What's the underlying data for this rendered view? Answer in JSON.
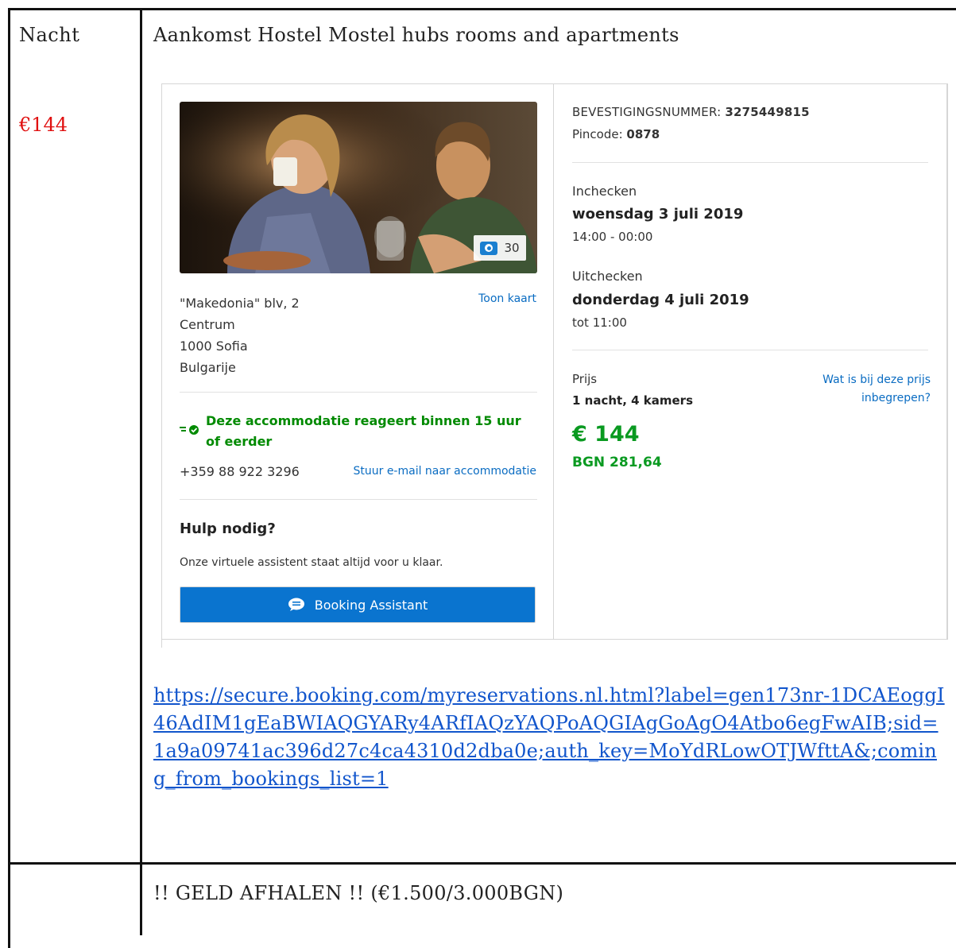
{
  "row1": {
    "label": "Nacht",
    "price": "€144",
    "title": "Aankomst Hostel Mostel hubs rooms and apartments",
    "url": "https://secure.booking.com/myreservations.nl.html?label=gen173nr-1DCAEoggI46AdIM1gEaBWIAQGYARy4ARfIAQzYAQPoAQGIAgGoAgO4Atbo6egFwAIB;sid=1a9a09741ac396d27c4ca4310d2dba0e;auth_key=MoYdRLowOTJWfttA&;coming_from_bookings_list=1"
  },
  "booking": {
    "photo_count": "30",
    "address": [
      "\"Makedonia\" blv, 2",
      "Centrum",
      "1000 Sofia",
      "Bulgarije"
    ],
    "map_link": "Toon kaart",
    "response_note": "Deze accommodatie reageert binnen 15 uur of eerder",
    "phone": "+359 88 922 3296",
    "email_link": "Stuur e-mail naar accommodatie",
    "help_title": "Hulp nodig?",
    "help_text": "Onze virtuele assistent staat altijd voor u klaar.",
    "assistant_button": "Booking Assistant",
    "confirmation_label": "BEVESTIGINGSNUMMER:",
    "confirmation_number": "3275449815",
    "pin_label": "Pincode:",
    "pin": "0878",
    "checkin_label": "Inchecken",
    "checkin_date": "woensdag 3 juli 2019",
    "checkin_time": "14:00 - 00:00",
    "checkout_label": "Uitchecken",
    "checkout_date": "donderdag 4 juli 2019",
    "checkout_time": "tot 11:00",
    "price_label": "Prijs",
    "price_included_link": "Wat is bij deze prijs inbegrepen?",
    "nights_rooms": "1 nacht, 4 kamers",
    "price_eur": "€ 144",
    "price_bgn": "BGN 281,64"
  },
  "row2": {
    "note": "!! GELD AFHALEN !! (€1.500/3.000BGN)"
  },
  "colors": {
    "link": "#1155cc",
    "price_red": "#e01010",
    "booking_green": "#0a9a21",
    "booking_blue": "#0a74cf"
  }
}
